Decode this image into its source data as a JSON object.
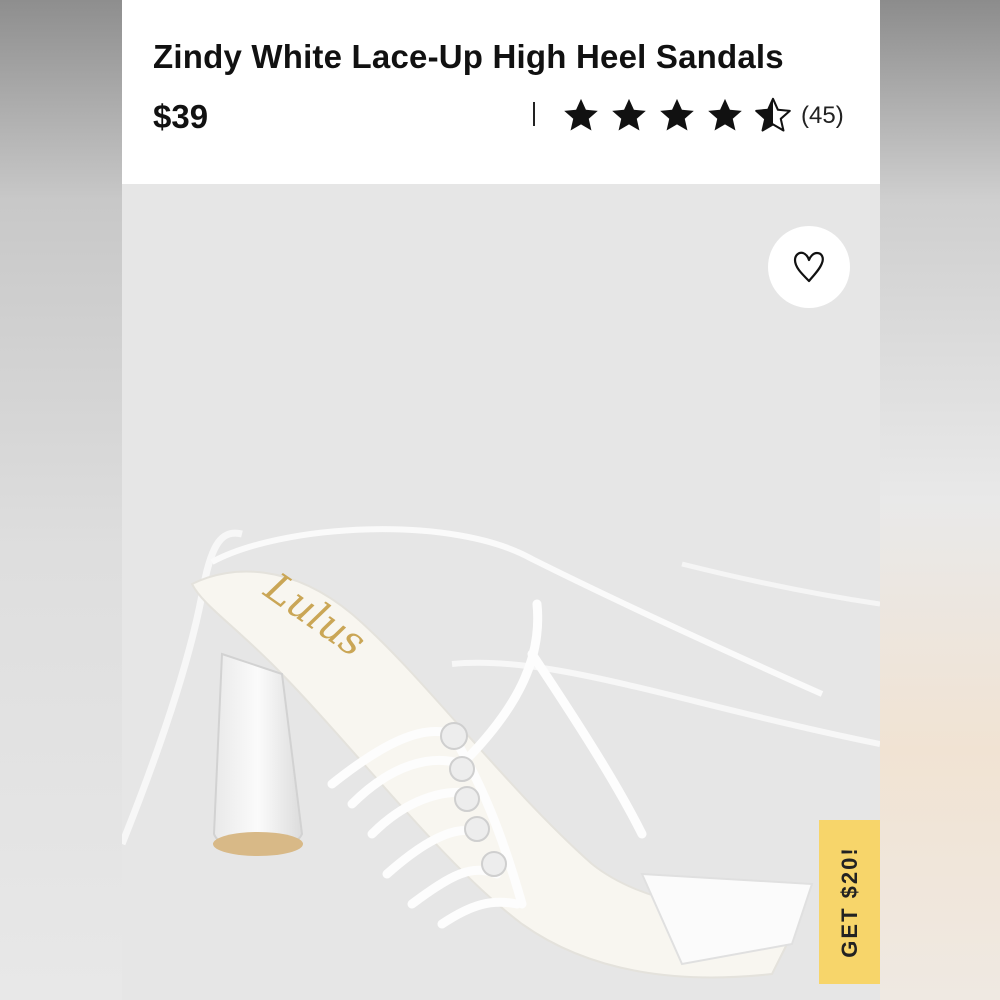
{
  "product": {
    "title": "Zindy White Lace-Up High Heel Sandals",
    "price": "$39",
    "rating": 4.5,
    "rating_max": 5,
    "review_count": "(45)",
    "brand_logo": "Lulus"
  },
  "icons": {
    "favorite": "heart-outline-icon",
    "star_full": "star-filled-icon",
    "star_half": "star-half-icon"
  },
  "promo": {
    "label": "GET $20!",
    "color": "#f7d56a"
  }
}
